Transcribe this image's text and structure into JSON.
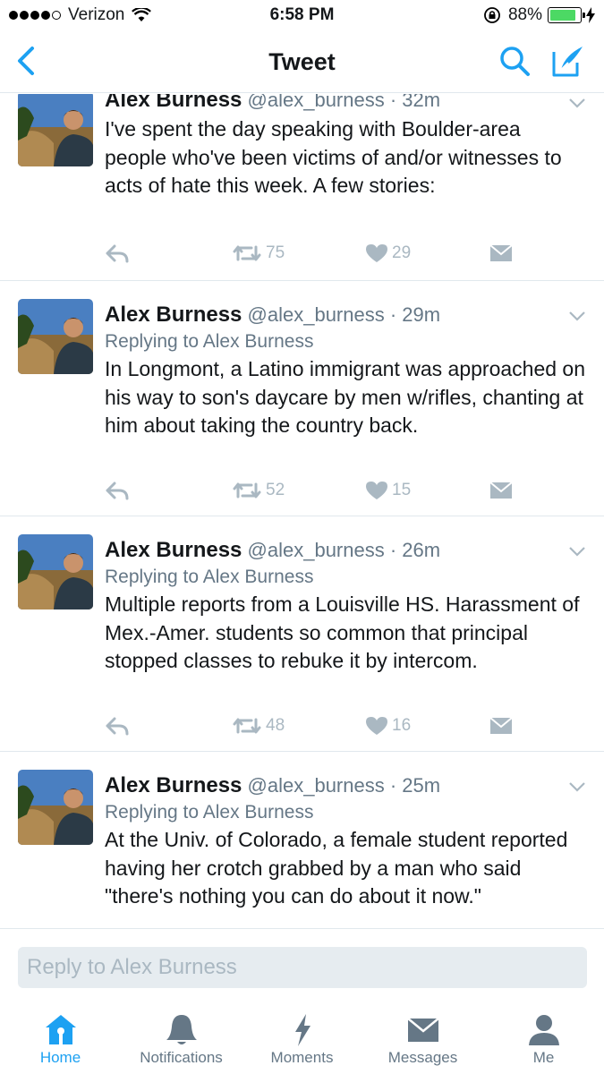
{
  "status_bar": {
    "carrier": "Verizon",
    "time": "6:58 PM",
    "battery": "88%",
    "battery_level": 0.88
  },
  "nav": {
    "title": "Tweet"
  },
  "tweets": [
    {
      "name": "Alex Burness",
      "handle": "@alex_burness",
      "time": "· 32m",
      "reply_to": "",
      "text": "I've spent the day speaking with Boulder-area people who've been victims of and/or witnesses to acts of hate this week. A few stories:",
      "retweets": "75",
      "likes": "29"
    },
    {
      "name": "Alex Burness",
      "handle": "@alex_burness",
      "time": "· 29m",
      "reply_to": "Replying to Alex Burness",
      "text": "In Longmont, a Latino immigrant was approached on his way to son's daycare by men w/rifles, chanting at him about taking the country back.",
      "retweets": "52",
      "likes": "15"
    },
    {
      "name": "Alex Burness",
      "handle": "@alex_burness",
      "time": "· 26m",
      "reply_to": "Replying to Alex Burness",
      "text": "Multiple reports from a Louisville HS. Harassment of Mex.-Amer. students so common that principal stopped classes to rebuke it by intercom.",
      "retweets": "48",
      "likes": "16"
    },
    {
      "name": "Alex Burness",
      "handle": "@alex_burness",
      "time": "· 25m",
      "reply_to": "Replying to Alex Burness",
      "text": "At the Univ. of Colorado, a female student reported having her crotch grabbed by a man who said \"there's nothing you can do about it now.\"",
      "retweets": "",
      "likes": ""
    }
  ],
  "reply_bar": {
    "placeholder": "Reply to Alex Burness"
  },
  "tabs": [
    {
      "label": "Home",
      "icon": "home-icon",
      "active": true
    },
    {
      "label": "Notifications",
      "icon": "bell-icon",
      "active": false
    },
    {
      "label": "Moments",
      "icon": "lightning-icon",
      "active": false
    },
    {
      "label": "Messages",
      "icon": "envelope-icon",
      "active": false
    },
    {
      "label": "Me",
      "icon": "person-icon",
      "active": false
    }
  ],
  "colors": {
    "accent": "#1da1f2",
    "muted": "#657786",
    "action_gray": "#aab8c2",
    "battery_green": "#4cd964"
  }
}
